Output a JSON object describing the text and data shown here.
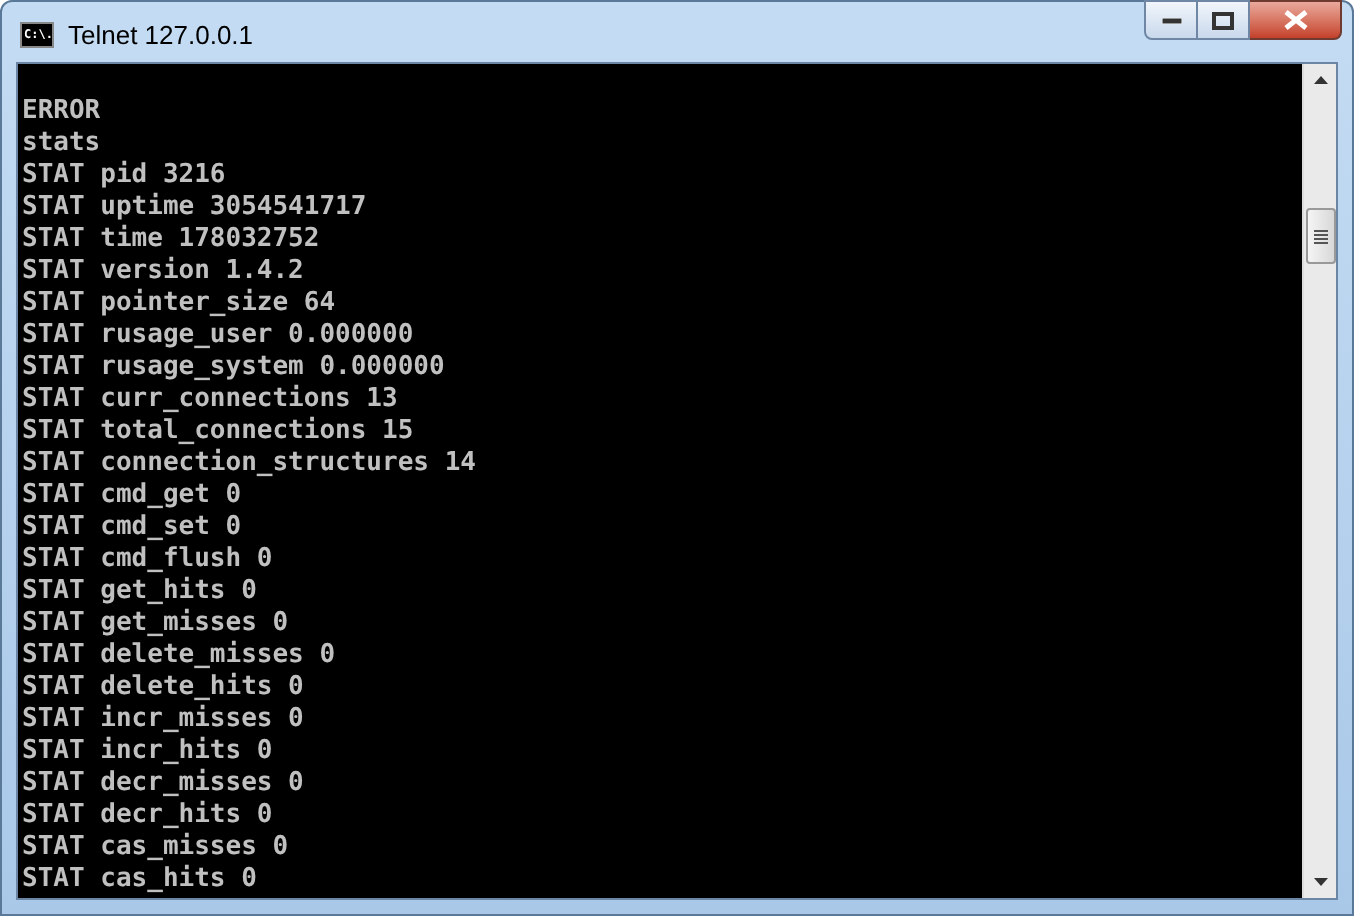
{
  "window": {
    "title": "Telnet 127.0.0.1",
    "icon_text": "C:\\."
  },
  "console": {
    "lines": [
      "ERROR",
      "stats",
      "STAT pid 3216",
      "STAT uptime 3054541717",
      "STAT time 178032752",
      "STAT version 1.4.2",
      "STAT pointer_size 64",
      "STAT rusage_user 0.000000",
      "STAT rusage_system 0.000000",
      "STAT curr_connections 13",
      "STAT total_connections 15",
      "STAT connection_structures 14",
      "STAT cmd_get 0",
      "STAT cmd_set 0",
      "STAT cmd_flush 0",
      "STAT get_hits 0",
      "STAT get_misses 0",
      "STAT delete_misses 0",
      "STAT delete_hits 0",
      "STAT incr_misses 0",
      "STAT incr_hits 0",
      "STAT decr_misses 0",
      "STAT decr_hits 0",
      "STAT cas_misses 0",
      "STAT cas_hits 0"
    ]
  }
}
